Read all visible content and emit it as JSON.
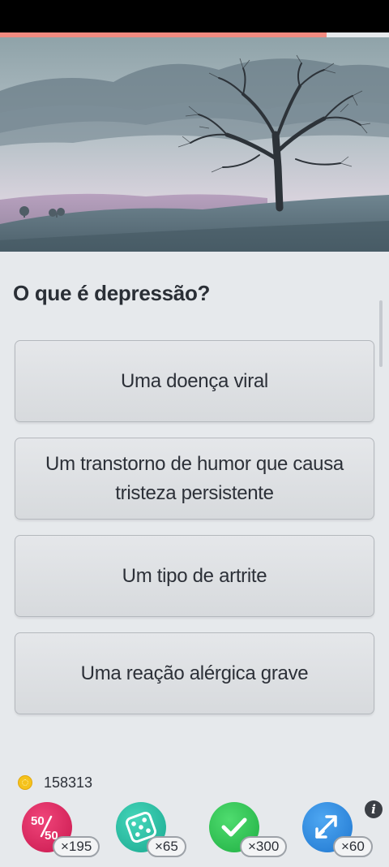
{
  "progress": {
    "fraction": 0.84,
    "color": "#f08a80"
  },
  "hero_image": {
    "subject": "bare tree on misty hill under grey sky"
  },
  "question": {
    "text": "O que é depressão?"
  },
  "answers": [
    {
      "text": "Uma doença viral"
    },
    {
      "text": "Um transtorno de humor que causa tristeza persistente"
    },
    {
      "text": "Um tipo de artrite"
    },
    {
      "text": "Uma reação alérgica grave"
    }
  ],
  "coins": {
    "value": "158313",
    "icon": "coin-icon"
  },
  "info": {
    "glyph": "i"
  },
  "lifelines": [
    {
      "name": "fifty-fifty",
      "icon": "fifty-fifty-icon",
      "label_top": "50",
      "label_bottom": "50",
      "count": "×195",
      "color": "#e0245e"
    },
    {
      "name": "dice",
      "icon": "dice-icon",
      "count": "×65",
      "color": "#2bbfa4"
    },
    {
      "name": "correct-answer",
      "icon": "checkmark-icon",
      "count": "×300",
      "color": "#2fc455"
    },
    {
      "name": "swap-question",
      "icon": "swap-arrows-icon",
      "count": "×60",
      "color": "#2f8be0"
    }
  ]
}
